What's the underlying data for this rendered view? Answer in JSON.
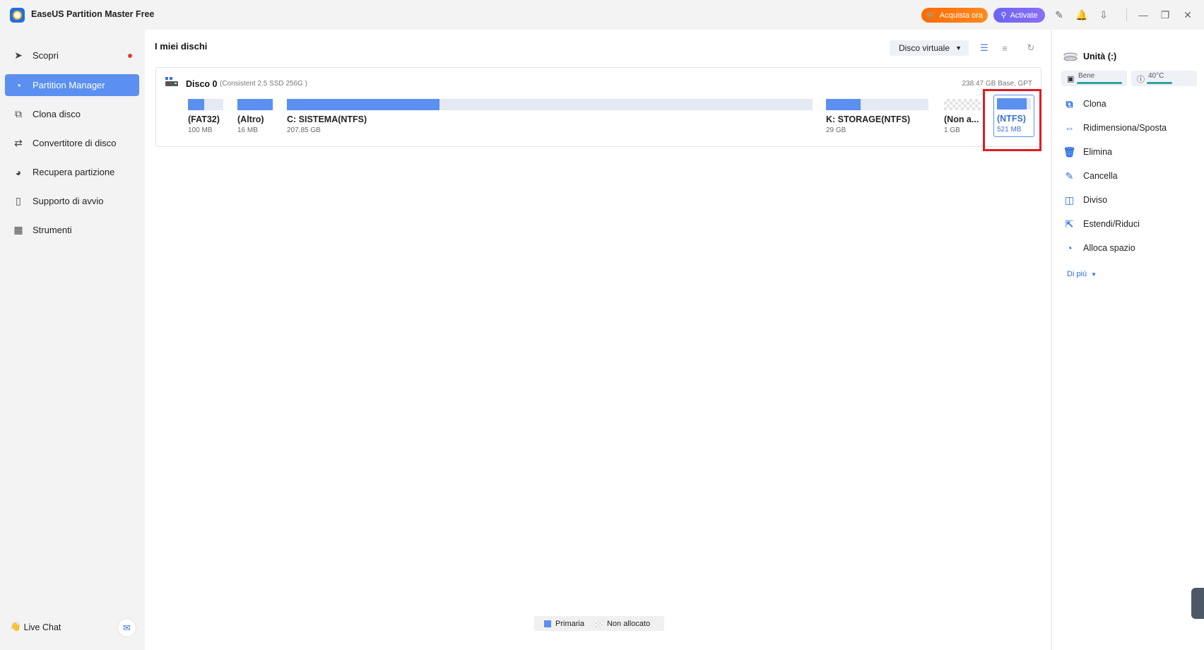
{
  "app": {
    "title": "EaseUS Partition Master Free",
    "buy_label": "Acquista ora",
    "activate_label": "Activate"
  },
  "sidebar": {
    "items": [
      {
        "label": "Scopri",
        "icon": "compass-icon"
      },
      {
        "label": "Partition Manager",
        "icon": "pie-chart-icon"
      },
      {
        "label": "Clona disco",
        "icon": "copy-icon"
      },
      {
        "label": "Convertitore di disco",
        "icon": "convert-icon"
      },
      {
        "label": "Recupera partizione",
        "icon": "recover-icon"
      },
      {
        "label": "Supporto di avvio",
        "icon": "usb-icon"
      },
      {
        "label": "Strumenti",
        "icon": "toolbox-icon"
      }
    ],
    "live_chat": "Live Chat"
  },
  "main": {
    "title": "I miei dischi",
    "virtual_disk": "Disco virtuale",
    "disk": {
      "name": "Disco 0",
      "subtitle": "(Consistent 2.5 SSD 256G )",
      "info": "238.47 GB Base, GPT",
      "partitions": [
        {
          "label": "(FAT32)",
          "size": "100 MB",
          "used_fraction": 0.45
        },
        {
          "label": "(Altro)",
          "size": "16 MB",
          "used_fraction": 1.0
        },
        {
          "label": "C: SISTEMA(NTFS)",
          "size": "207.85 GB",
          "used_fraction": 0.29
        },
        {
          "label": "K: STORAGE(NTFS)",
          "size": "29 GB",
          "used_fraction": 0.34
        },
        {
          "label": "(Non a...",
          "size": "1 GB",
          "used_fraction": 0
        },
        {
          "label": "(NTFS)",
          "size": "521 MB",
          "used_fraction": 0.88
        }
      ]
    },
    "legend": {
      "primary": "Primaria",
      "unallocated": "Non allocato",
      "primary_color": "#5b8ff0"
    }
  },
  "right_panel": {
    "unit_title": "Unità (:)",
    "health": "Bene",
    "temperature": "40°C",
    "actions": [
      {
        "label": "Clona",
        "icon": "clone-icon"
      },
      {
        "label": "Ridimensiona/Sposta",
        "icon": "resize-icon"
      },
      {
        "label": "Elimina",
        "icon": "trash-icon"
      },
      {
        "label": "Cancella",
        "icon": "eraser-icon"
      },
      {
        "label": "Diviso",
        "icon": "split-icon"
      },
      {
        "label": "Estendi/Riduci",
        "icon": "extend-icon"
      },
      {
        "label": "Alloca spazio",
        "icon": "allocate-icon"
      }
    ],
    "more_label": "Di più"
  },
  "colors": {
    "accent": "#5b8ff0",
    "highlight_box": "#e01b24",
    "buy": "#ff6a00",
    "activate": "#7466f3"
  }
}
